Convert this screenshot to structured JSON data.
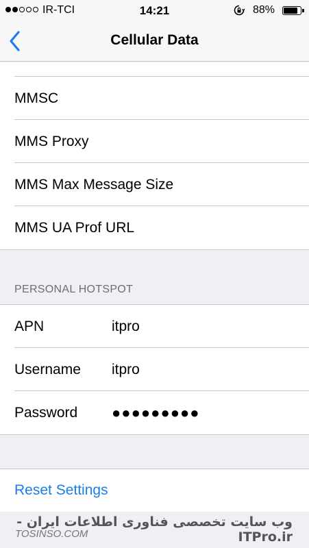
{
  "status_bar": {
    "signal_dots_filled": 2,
    "signal_dots_total": 5,
    "carrier": "IR-TCI",
    "time": "14:21",
    "rotation_lock_icon": "rotation-lock-icon",
    "battery_percent": "88%",
    "battery_level": 0.88
  },
  "nav": {
    "back_icon": "chevron-left-icon",
    "title": "Cellular Data",
    "accent_color": "#1a7ee8"
  },
  "mms_rows": [
    {
      "label": "MMSC"
    },
    {
      "label": "MMS Proxy"
    },
    {
      "label": "MMS Max Message Size"
    },
    {
      "label": "MMS UA Prof URL"
    }
  ],
  "hotspot": {
    "header": "PERSONAL HOTSPOT",
    "rows": [
      {
        "label": "APN",
        "value": "itpro"
      },
      {
        "label": "Username",
        "value": "itpro"
      },
      {
        "label": "Password",
        "value": "●●●●●●●●●"
      }
    ]
  },
  "reset": {
    "label": "Reset Settings"
  },
  "watermark": {
    "line1": "وب سایت تخصصی فناوری اطلاعات ایران - ITPro.ir",
    "line2": "TOSINSO.COM"
  }
}
